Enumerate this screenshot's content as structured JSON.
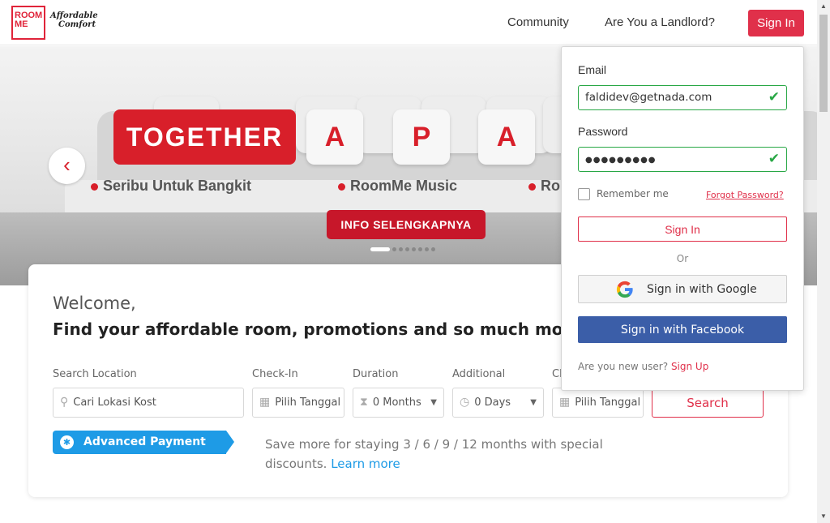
{
  "header": {
    "logo_line1": "ROOM",
    "logo_line2": "ME",
    "logo_tagline1": "Affordable",
    "logo_tagline2": "Comfort",
    "nav": [
      "Community",
      "Are You a Landlord?"
    ],
    "sign_in": "Sign In"
  },
  "hero": {
    "pillow_red": "TOGETHER",
    "pillow_letters": [
      "A",
      "P",
      "A"
    ],
    "captions": [
      "Seribu Untuk Bangkit",
      "RoomMe Music",
      "Ro"
    ],
    "cta": "INFO SELENGKAPNYA",
    "prev_icon": "‹"
  },
  "search": {
    "welcome": "Welcome,",
    "headline": "Find your affordable room, promotions and so much mo",
    "labels": {
      "location": "Search Location",
      "checkin": "Check-In",
      "duration": "Duration",
      "additional": "Additional",
      "checkout": "Ch"
    },
    "location_placeholder": "Cari Lokasi Kost",
    "checkin_placeholder": "Pilih Tanggal",
    "duration_value": "0 Months",
    "additional_value": "0 Days",
    "checkout_placeholder": "Pilih Tanggal",
    "search_button": "Search",
    "deal_badge": "Advanced Payment Deals",
    "promo_text": "Save more for staying 3 / 6 / 9 / 12 months with special discounts.",
    "promo_link": "Learn more"
  },
  "login": {
    "email_label": "Email",
    "email_value": "faldidev@getnada.com",
    "password_label": "Password",
    "password_value": "●●●●●●●●●",
    "remember": "Remember me",
    "forgot": "Forgot Password?",
    "sign_in": "Sign In",
    "or": "Or",
    "google": "Sign in with Google",
    "facebook": "Sign in with Facebook",
    "new_user": "Are you new user?",
    "sign_up": "Sign Up"
  },
  "colors": {
    "brand_red": "#e0304a",
    "success_green": "#28a745",
    "facebook_blue": "#3b5ea8",
    "info_blue": "#1e9be6"
  }
}
